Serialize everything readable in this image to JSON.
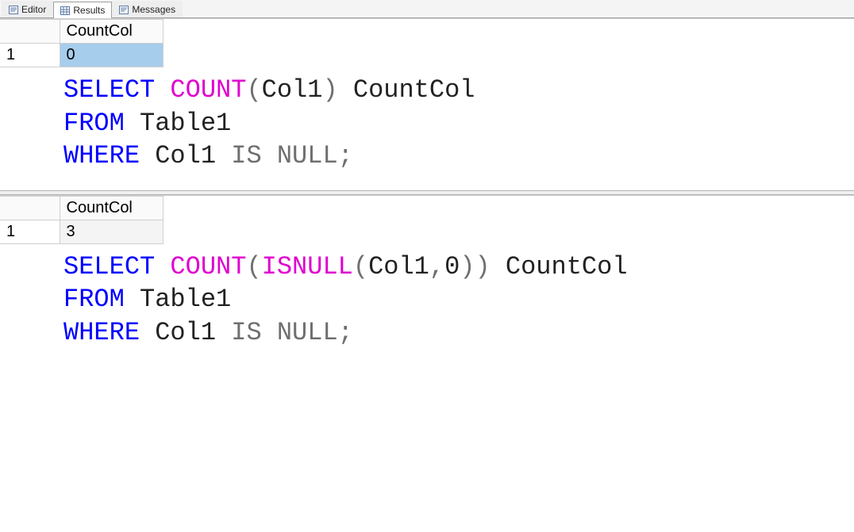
{
  "tabs": {
    "editor": "Editor",
    "results": "Results",
    "messages": "Messages",
    "active": "results"
  },
  "result1": {
    "row": "1",
    "col": "CountCol",
    "value": "0"
  },
  "sql1": {
    "select": "SELECT",
    "count": "COUNT",
    "lp1": "(",
    "col1": "Col1",
    "rp1": ")",
    "alias": "CountCol",
    "from": "FROM",
    "table": "Table1",
    "where": "WHERE",
    "wcol": "Col1",
    "is": "IS",
    "null": "NULL",
    "semi": ";"
  },
  "result2": {
    "row": "1",
    "col": "CountCol",
    "value": "3"
  },
  "sql2": {
    "select": "SELECT",
    "count": "COUNT",
    "lp1": "(",
    "isnull": "ISNULL",
    "lp2": "(",
    "col1": "Col1",
    "comma": ",",
    "zero": "0",
    "rp2": ")",
    "rp1": ")",
    "alias": "CountCol",
    "from": "FROM",
    "table": "Table1",
    "where": "WHERE",
    "wcol": "Col1",
    "is": "IS",
    "null": "NULL",
    "semi": ";"
  }
}
